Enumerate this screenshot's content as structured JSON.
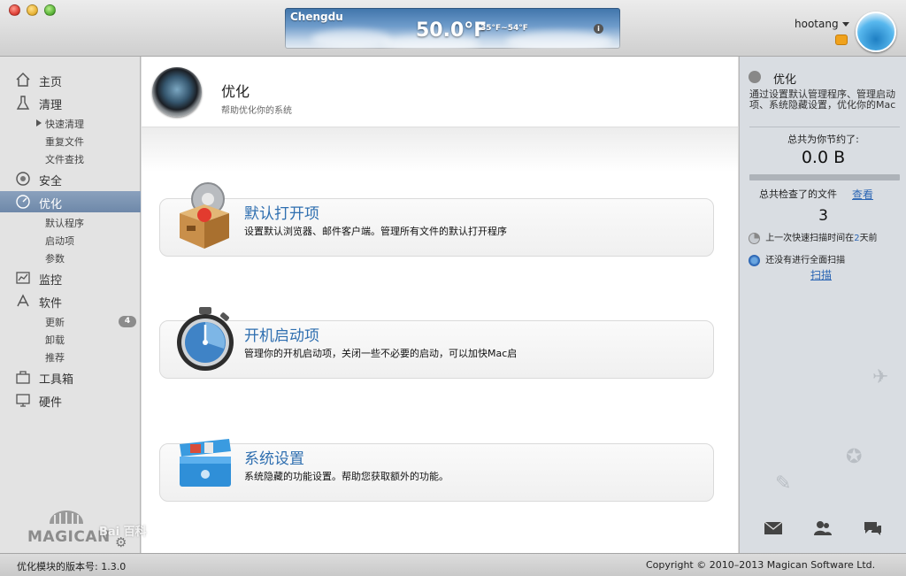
{
  "weather": {
    "city": "Chengdu",
    "temperature": "50.0°F",
    "range": "35°F~54°F",
    "info_icon": "info-icon"
  },
  "user": {
    "name": "hootang"
  },
  "sidebar": {
    "items": [
      {
        "label": "主页",
        "icon": "home-icon"
      },
      {
        "label": "清理",
        "icon": "broom-icon"
      },
      {
        "label": "安全",
        "icon": "shield-icon"
      },
      {
        "label": "优化",
        "icon": "gauge-icon"
      },
      {
        "label": "监控",
        "icon": "monitor-chart-icon"
      },
      {
        "label": "软件",
        "icon": "app-icon"
      },
      {
        "label": "工具箱",
        "icon": "toolbox-icon"
      },
      {
        "label": "硬件",
        "icon": "hardware-icon"
      }
    ],
    "clean_sub": [
      "快速清理",
      "重复文件",
      "文件查找"
    ],
    "optimize_sub": [
      "默认程序",
      "启动项",
      "参数"
    ],
    "software_sub": [
      "更新",
      "卸载",
      "推荐"
    ],
    "update_count": "4",
    "logo_text": "MAGICAN"
  },
  "main": {
    "title": "优化",
    "subtitle": "帮助优化你的系统",
    "cards": [
      {
        "title": "默认打开项",
        "desc": "设置默认浏览器、邮件客户端。管理所有文件的默认打开程序"
      },
      {
        "title": "开机启动项",
        "desc": "管理你的开机启动项，关闭一些不必要的启动，可以加快Mac启"
      },
      {
        "title": "系统设置",
        "desc": "系统隐藏的功能设置。帮助您获取额外的功能。"
      }
    ]
  },
  "right_panel": {
    "title": "优化",
    "description": "通过设置默认管理程序、管理启动项、系统隐藏设置，优化你的Mac",
    "saved_label": "总共为你节约了:",
    "saved_value": "0.0 B",
    "checked_label": "总共检查了的文件",
    "view_link": "查看",
    "checked_value": "3",
    "last_quick_scan_prefix": "上一次快速扫描时间在",
    "last_quick_scan_days": "2",
    "last_quick_scan_suffix": "天前",
    "full_scan_status": "还没有进行全面扫描",
    "scan_link": "扫描"
  },
  "status": {
    "version": "优化模块的版本号: 1.3.0",
    "copyright": "Copyright © 2010–2013 Magican Software Ltd."
  },
  "watermark": "Bai 百科"
}
